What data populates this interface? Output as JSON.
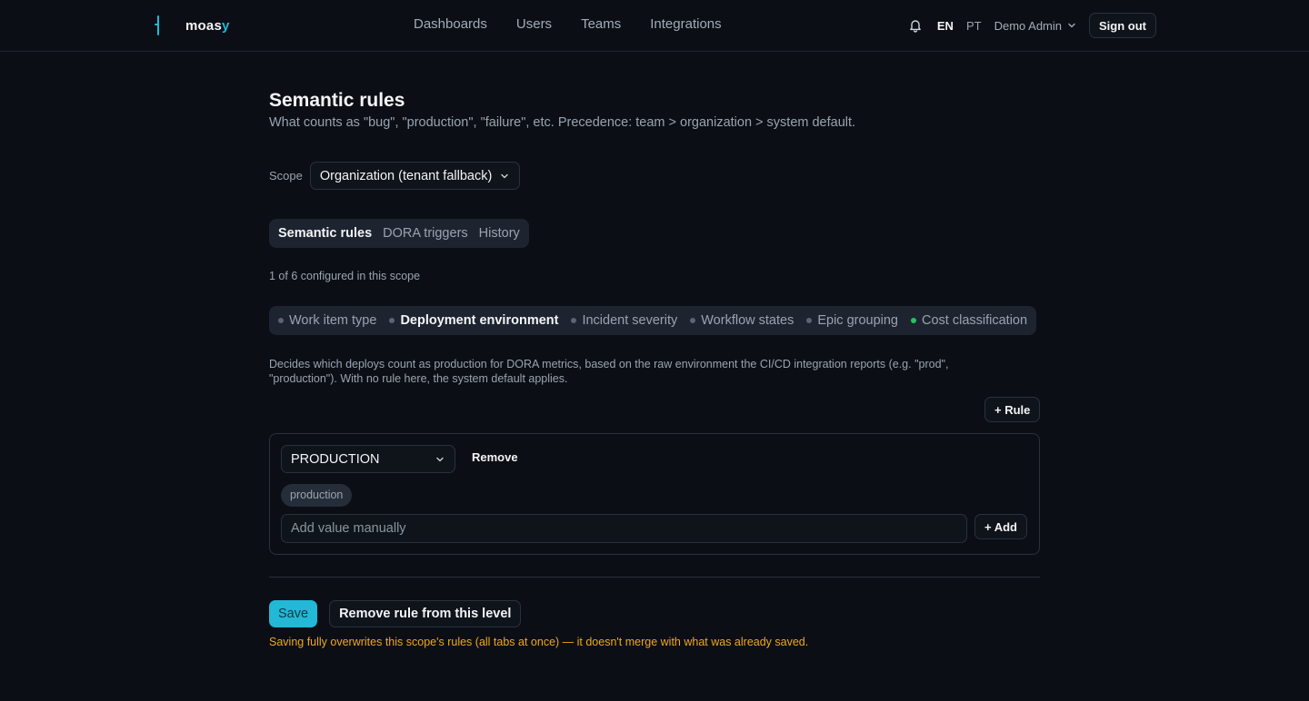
{
  "colors": {
    "accent": "#22b8d6",
    "warning": "#f0a71b",
    "configured_dot": "#22c55e",
    "background": "#0b0f15"
  },
  "header": {
    "brand": {
      "text_main": "moas",
      "text_accent": "y",
      "logo_icon": "brand-bar-icon"
    },
    "nav": [
      "Dashboards",
      "Users",
      "Teams",
      "Integrations"
    ],
    "notification_icon": "bell-icon",
    "languages": {
      "active": "EN",
      "inactive": "PT"
    },
    "user_label": "Demo Admin",
    "signout_label": "Sign out"
  },
  "page": {
    "title": "Semantic rules",
    "subtitle": "What counts as \"bug\", \"production\", \"failure\", etc. Precedence: team > organization > system default."
  },
  "scope": {
    "label": "Scope",
    "value": "Organization (tenant fallback)"
  },
  "tabs": [
    {
      "label": "Semantic rules",
      "active": true
    },
    {
      "label": "DORA triggers",
      "active": false
    },
    {
      "label": "History",
      "active": false
    }
  ],
  "configured_text": "1 of 6 configured in this scope",
  "rule_types": [
    {
      "label": "Work item type",
      "active": false,
      "configured": false
    },
    {
      "label": "Deployment environment",
      "active": true,
      "configured": false
    },
    {
      "label": "Incident severity",
      "active": false,
      "configured": false
    },
    {
      "label": "Workflow states",
      "active": false,
      "configured": false
    },
    {
      "label": "Epic grouping",
      "active": false,
      "configured": false
    },
    {
      "label": "Cost classification",
      "active": false,
      "configured": true
    }
  ],
  "description": "Decides which deploys count as production for DORA metrics, based on the raw environment the CI/CD integration reports (e.g. \"prod\", \"production\"). With no rule here, the system default applies.",
  "add_rule_label": "+ Rule",
  "rule": {
    "category": "PRODUCTION",
    "remove_label": "Remove",
    "values": [
      "production"
    ],
    "input_placeholder": "Add value manually",
    "add_label": "+ Add"
  },
  "actions": {
    "save_label": "Save",
    "remove_level_label": "Remove rule from this level"
  },
  "warning": "Saving fully overwrites this scope's rules (all tabs at once) — it doesn't merge with what was already saved."
}
